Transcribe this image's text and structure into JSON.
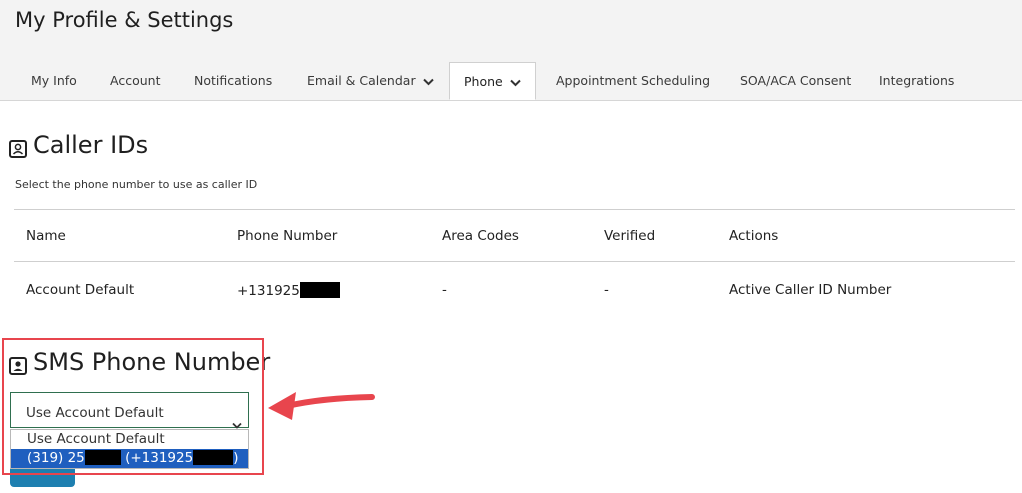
{
  "page": {
    "title": "My Profile & Settings"
  },
  "tabs": [
    {
      "label": "My Info"
    },
    {
      "label": "Account"
    },
    {
      "label": "Notifications"
    },
    {
      "label": "Email & Calendar",
      "has_dropdown": true
    },
    {
      "label": "Phone",
      "has_dropdown": true,
      "active": true
    },
    {
      "label": "Appointment Scheduling"
    },
    {
      "label": "SOA/ACA Consent"
    },
    {
      "label": "Integrations"
    }
  ],
  "caller_ids": {
    "title": "Caller IDs",
    "description": "Select the phone number to use as caller ID",
    "columns": [
      "Name",
      "Phone Number",
      "Area Codes",
      "Verified",
      "Actions"
    ],
    "rows": [
      {
        "name": "Account Default",
        "phone": "+131925",
        "area_codes": "-",
        "verified": "-",
        "actions": "Active Caller ID Number"
      }
    ]
  },
  "sms": {
    "title": "SMS Phone Number",
    "selected_value": "Use Account Default",
    "options": [
      {
        "label": "Use Account Default"
      },
      {
        "label_prefix": "(319) 25",
        "label_mid": "(+131925",
        "label_suffix": ")",
        "highlighted": true
      }
    ]
  },
  "colors": {
    "accent": "#1f5fbf",
    "annotation": "#e8454d",
    "select_border": "#2f6f4f"
  },
  "icons": {
    "contact": "contact-card-icon",
    "chevron": "chevron-down-icon",
    "arrow": "annotation-arrow-icon"
  }
}
